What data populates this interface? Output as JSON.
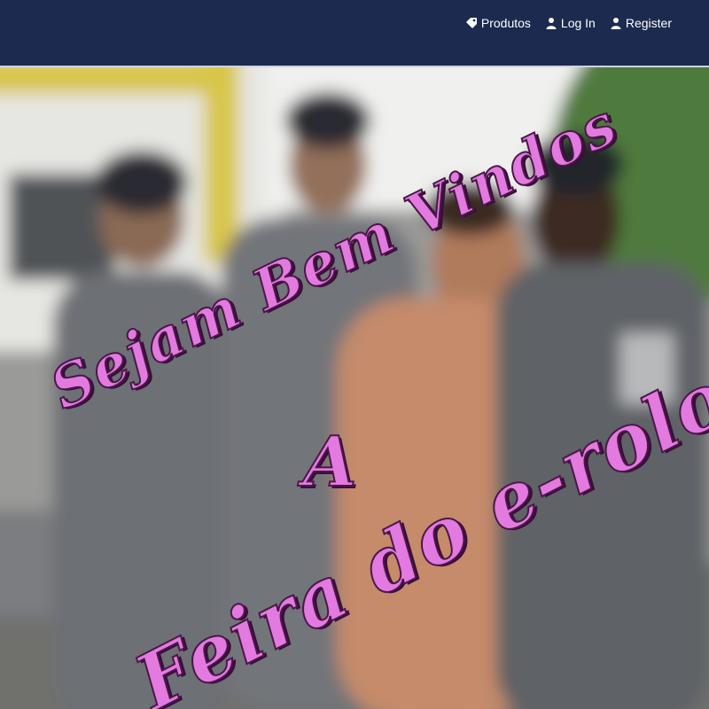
{
  "navbar": {
    "items": [
      {
        "label": "Produtos",
        "icon": "tag-icon"
      },
      {
        "label": "Log In",
        "icon": "user-icon"
      },
      {
        "label": "Register",
        "icon": "user-icon"
      }
    ],
    "background": "#1b2a4e"
  },
  "hero": {
    "line1": "Sejam Bem Vindos",
    "line2": "A",
    "line3": "Feira do e-rolo",
    "text_color": "#e37ae0"
  }
}
